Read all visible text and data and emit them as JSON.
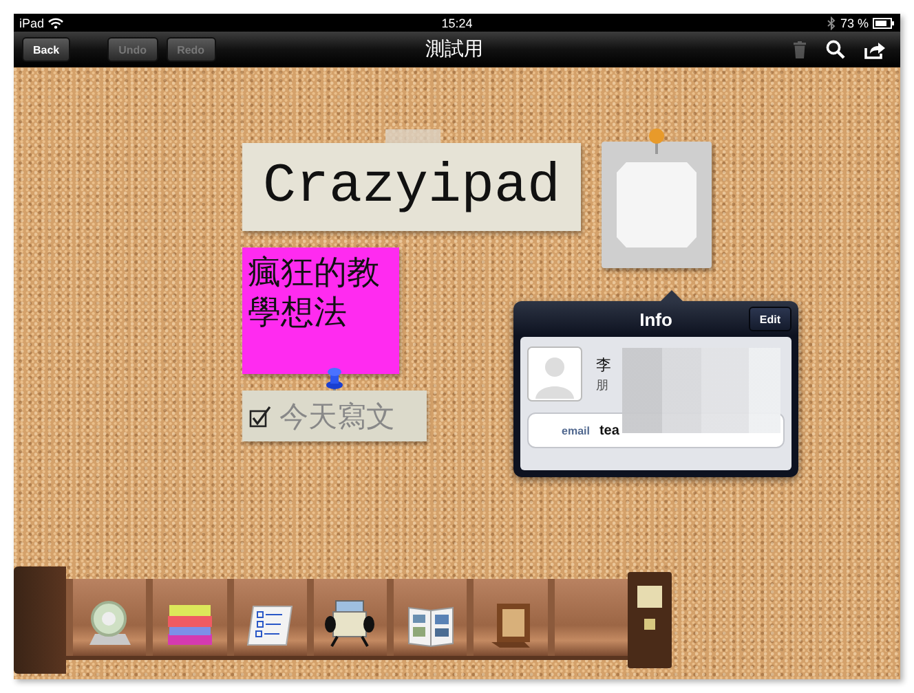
{
  "status_bar": {
    "device": "iPad",
    "time": "15:24",
    "battery": "73 %"
  },
  "nav_bar": {
    "title": "測試用",
    "trash_disabled": true,
    "buttons": [
      {
        "label": "Back",
        "disabled": false
      },
      {
        "label": "Undo",
        "disabled": true
      },
      {
        "label": "Redo",
        "disabled": true
      }
    ]
  },
  "board": {
    "notes": [
      {
        "kind": "label",
        "text": "Crazyipad"
      },
      {
        "kind": "sticky",
        "text": "瘋狂的教學想法"
      },
      {
        "kind": "todo",
        "text": "今天寫文",
        "checked": true
      }
    ]
  },
  "popover": {
    "title": "Info",
    "edit_button": "Edit",
    "name": "李",
    "subtitle": "朋",
    "field_label": "email",
    "field_value": "tea"
  }
}
